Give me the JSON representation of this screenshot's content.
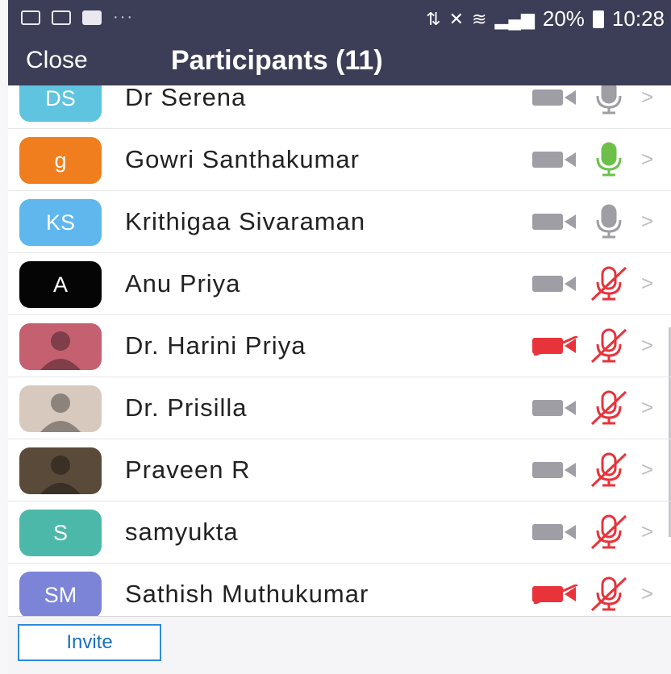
{
  "status_bar": {
    "battery": "20%",
    "time": "10:28",
    "overflow": "···"
  },
  "header": {
    "close_label": "Close",
    "title": "Participants (11)"
  },
  "participants": [
    {
      "initials": "DS",
      "name": "Dr Serena",
      "avatar_color": "#5ec4e0",
      "video": "off",
      "mic": "on-idle"
    },
    {
      "initials": "g",
      "name": "Gowri Santhakumar",
      "avatar_color": "#f07e1e",
      "video": "off",
      "mic": "on-speaking"
    },
    {
      "initials": "KS",
      "name": "Krithigaa Sivaraman",
      "avatar_color": "#5fb7ee",
      "video": "off",
      "mic": "on-idle"
    },
    {
      "initials": "A",
      "name": "Anu Priya",
      "avatar_color": "#050505",
      "video": "off",
      "mic": "muted"
    },
    {
      "initials": "",
      "name": "Dr. Harini Priya",
      "avatar_color": "#c46070",
      "video": "blocked",
      "mic": "muted"
    },
    {
      "initials": "",
      "name": "Dr. Prisilla",
      "avatar_color": "#d8c9bf",
      "video": "off",
      "mic": "muted"
    },
    {
      "initials": "",
      "name": "Praveen R",
      "avatar_color": "#5a4a3a",
      "video": "off",
      "mic": "muted"
    },
    {
      "initials": "S",
      "name": "samyukta",
      "avatar_color": "#4cb8aa",
      "video": "off",
      "mic": "muted"
    },
    {
      "initials": "SM",
      "name": "Sathish Muthukumar",
      "avatar_color": "#7b84d6",
      "video": "blocked",
      "mic": "muted"
    }
  ],
  "footer": {
    "invite_label": "Invite"
  },
  "colors": {
    "header_bg": "#3c3d56",
    "mic_green": "#6cc04a",
    "muted_red": "#e8333b",
    "icon_gray": "#9e9ea4"
  }
}
